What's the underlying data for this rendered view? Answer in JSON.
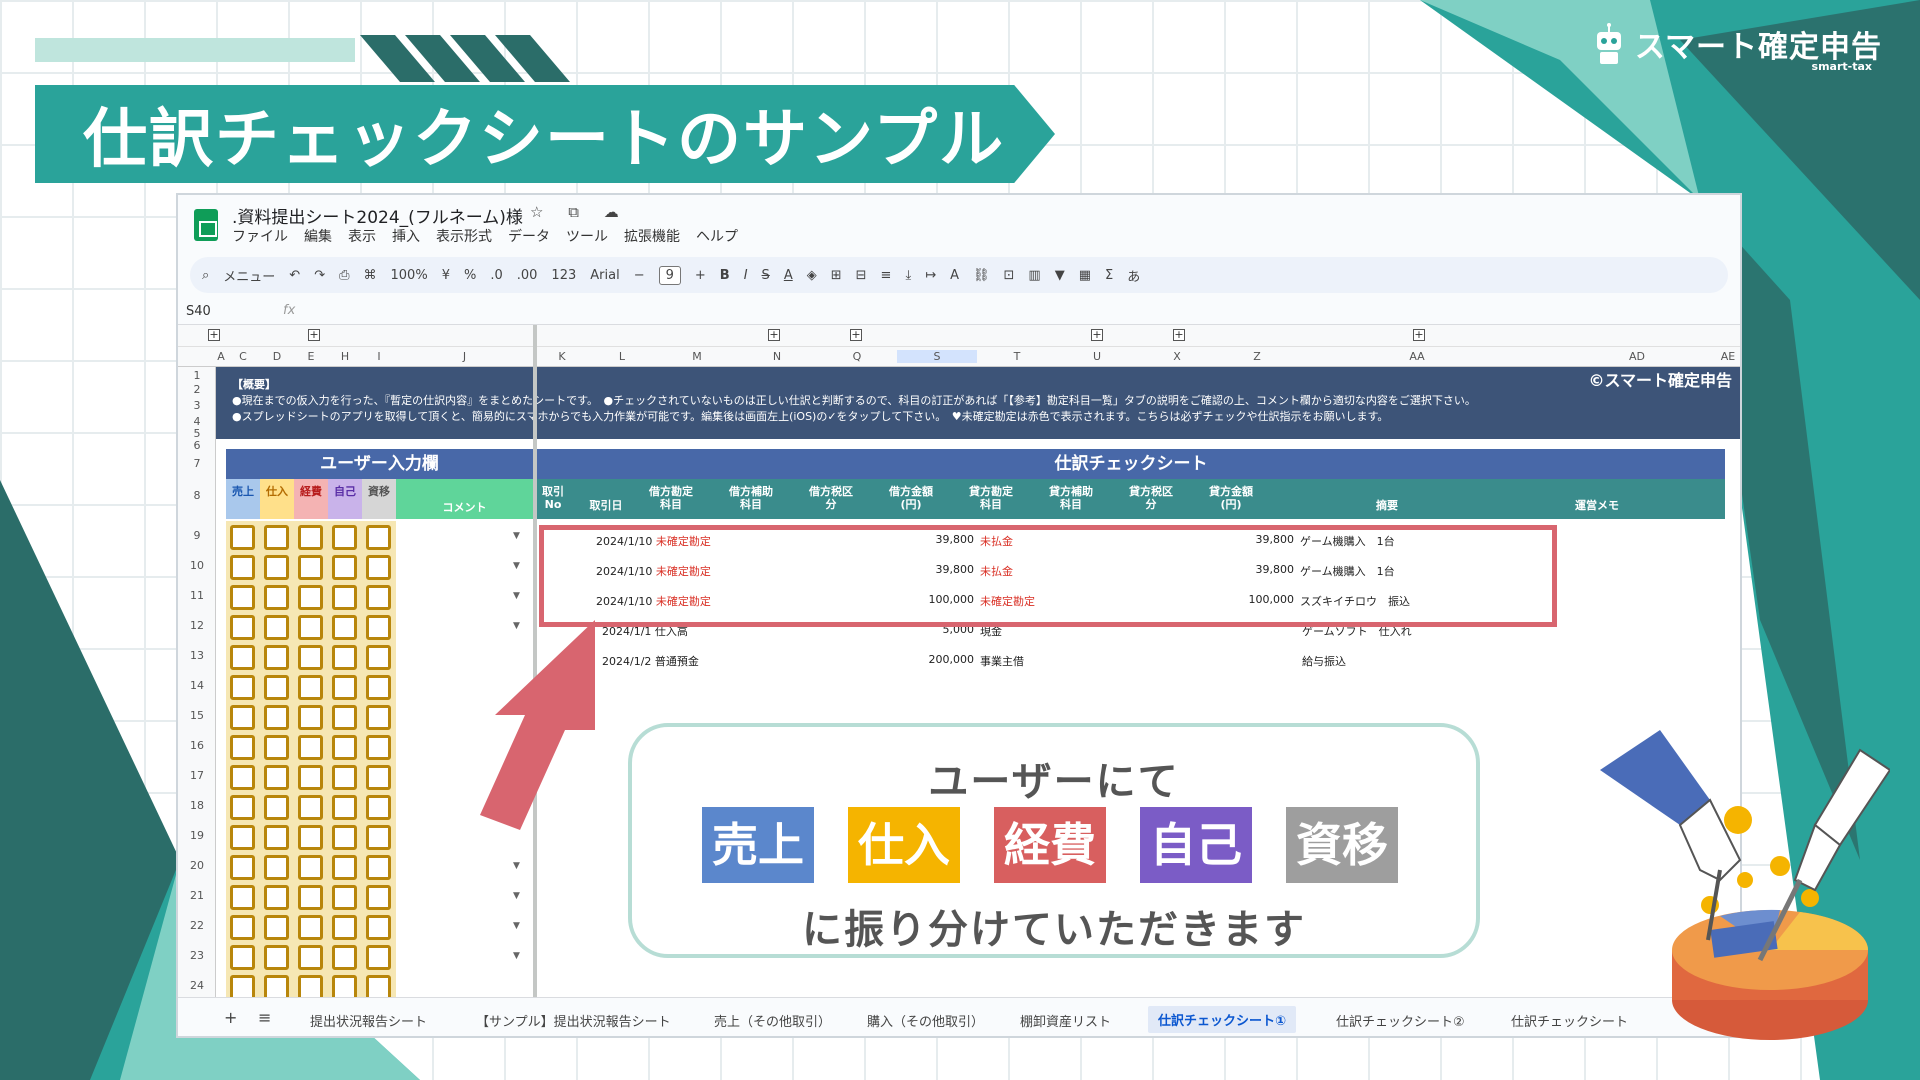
{
  "slide": {
    "title": "仕訳チェックシートのサンプル",
    "brand_name": "スマート確定申告",
    "brand_sub": "smart-tax"
  },
  "sheet": {
    "doc_title": ".資料提出シート2024_(フルネーム)様",
    "doc_icons": "☆ ⧉ ☁",
    "menu": [
      "ファイル",
      "編集",
      "表示",
      "挿入",
      "表示形式",
      "データ",
      "ツール",
      "拡張機能",
      "ヘルプ"
    ],
    "toolbar": {
      "search": "メニュー",
      "zoom": "100%",
      "currency": "¥",
      "percent": "%",
      "dec_less": ".0",
      "dec_more": ".00",
      "num": "123",
      "font": "Arial",
      "font_size": "9",
      "bold": "B",
      "italic": "I",
      "strike": "S",
      "text_color": "A",
      "sum": "Σ",
      "input": "あ"
    },
    "cell_ref": "S40",
    "fx": "fx",
    "columns": [
      "A",
      "C",
      "D",
      "E",
      "H",
      "I",
      "J",
      "K",
      "L",
      "M",
      "N",
      "Q",
      "S",
      "T",
      "U",
      "X",
      "Z",
      "AA",
      "AD",
      "AE"
    ],
    "rows": [
      "1",
      "2",
      "3",
      "4",
      "5",
      "6",
      "7",
      "8",
      "9",
      "10",
      "11",
      "12",
      "13",
      "14",
      "15",
      "16",
      "17",
      "18",
      "19",
      "20",
      "21",
      "22",
      "23",
      "24"
    ],
    "overview": {
      "heading": "【概要】",
      "line1": "●現在までの仮入力を行った、『暫定の仕訳内容』をまとめたシートです。　●チェックされていないものは正しい仕訳と判断するので、科目の訂正があれば「【参考】勘定科目一覧」タブの説明をご確認の上、コメント欄から適切な内容をご選択下さい。",
      "line2": "●スプレッドシートのアプリを取得して頂くと、簡易的にスマホからでも入力作業が可能です。編集後は画面左上(iOS)の✓をタップして下さい。　♥未確定勘定は赤色で表示されます。こちらは必ずチェックや仕訳指示をお願いします。",
      "logo": "©スマート確定申告"
    },
    "user_section": "ユーザー入力欄",
    "check_section": "仕訳チェックシート",
    "user_headers": [
      "売上",
      "仕入",
      "経費",
      "自己",
      "資移",
      "コメント"
    ],
    "check_headers": [
      "取引No",
      "取引日",
      "借方勘定科目",
      "借方補助科目",
      "借方税区分",
      "借方金額(円)",
      "貸方勘定科目",
      "貸方補助科目",
      "貸方税区分",
      "貸方金額(円)",
      "摘要",
      "運営メモ"
    ],
    "journal": [
      {
        "date": "2024/1/10",
        "debit": "未確定勘定",
        "debit_amount": "39,800",
        "credit": "未払金",
        "credit_amount": "39,800",
        "memo": "ゲーム機購入　1台"
      },
      {
        "date": "2024/1/10",
        "debit": "未確定勘定",
        "debit_amount": "39,800",
        "credit": "未払金",
        "credit_amount": "39,800",
        "memo": "ゲーム機購入　1台"
      },
      {
        "date": "2024/1/10",
        "debit": "未確定勘定",
        "debit_amount": "100,000",
        "credit": "未確定勘定",
        "credit_amount": "100,000",
        "memo": "スズキイチロウ　振込"
      },
      {
        "date": "2024/1/1",
        "debit": "仕入高",
        "debit_amount": "5,000",
        "credit": "現金",
        "credit_amount": "",
        "memo": "ゲームソフト　仕入れ"
      },
      {
        "date": "2024/1/2",
        "debit": "普通預金",
        "debit_amount": "200,000",
        "credit": "事業主借",
        "credit_amount": "",
        "memo": "給与振込"
      }
    ],
    "tabs": [
      "+",
      "≡",
      "提出状況報告シート",
      "【サンプル】提出状況報告シート",
      "売上（その他取引）",
      "購入（その他取引）",
      "棚卸資産リスト",
      "仕訳チェックシート①",
      "仕訳チェックシート②",
      "仕訳チェックシート"
    ]
  },
  "callout": {
    "top": "ユーザーにて",
    "bottom": "に振り分けていただきます",
    "categories": [
      {
        "label": "売上",
        "color": "#5b87cc"
      },
      {
        "label": "仕入",
        "color": "#f5b400"
      },
      {
        "label": "経費",
        "color": "#d85f5f"
      },
      {
        "label": "自己",
        "color": "#7b5cc6"
      },
      {
        "label": "資移",
        "color": "#9e9e9e"
      }
    ]
  },
  "colors": {
    "teal": "#2aa39a",
    "dark_teal": "#2b6d69",
    "navy": "#3d5478",
    "header_blue": "#4868a8",
    "sub_teal": "#3a8c8c",
    "red_box": "#d8656f"
  }
}
